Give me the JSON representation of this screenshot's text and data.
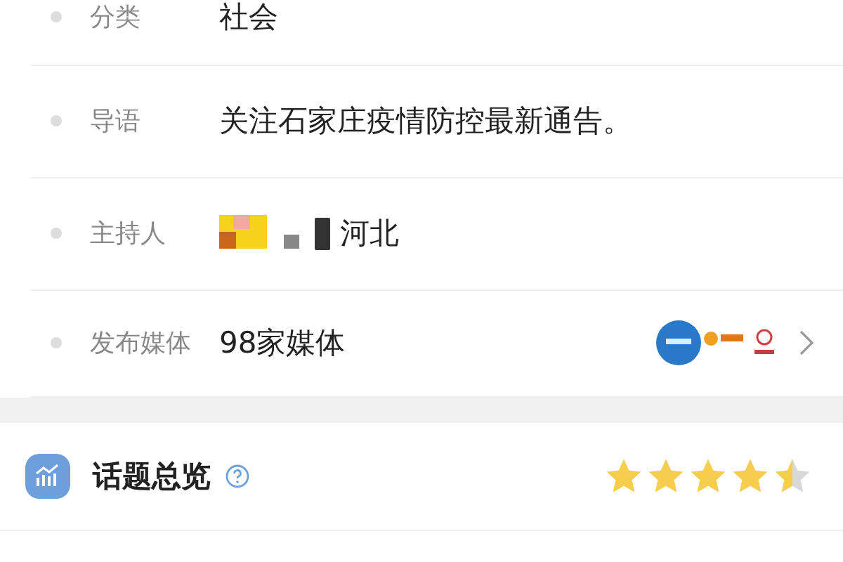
{
  "info_rows": [
    {
      "kind": "text",
      "label": "分类",
      "value": "社会"
    },
    {
      "kind": "text",
      "label": "导语",
      "value": "关注石家庄疫情防控最新通告。"
    },
    {
      "kind": "host",
      "label": "主持人",
      "value": "河北"
    },
    {
      "kind": "media",
      "label": "发布媒体",
      "value": "98家媒体"
    }
  ],
  "overview": {
    "title": "话题总览",
    "stars": 4.5
  }
}
